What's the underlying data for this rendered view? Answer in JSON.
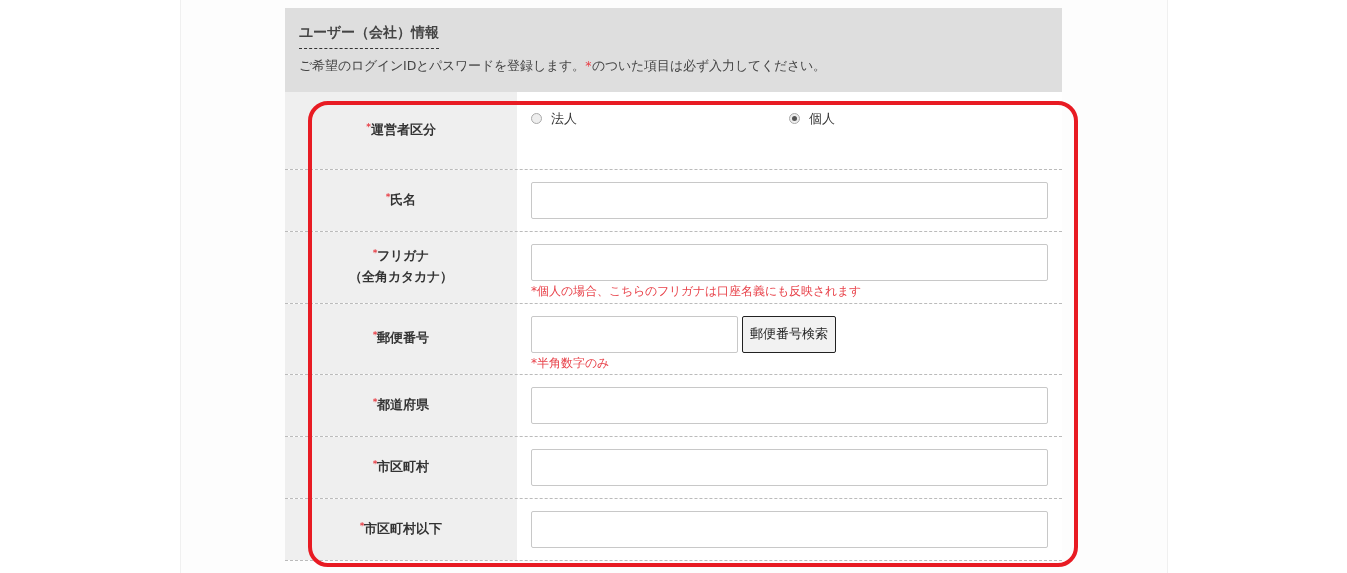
{
  "section": {
    "title": "ユーザー（会社）情報",
    "intro": {
      "before": "ご希望のログインIDとパスワードを登録します。",
      "mark": "*",
      "after": "のついた項目は必ず入力してください。"
    }
  },
  "rows": [
    {
      "kind": "radio",
      "required": true,
      "label": "運営者区分",
      "options": [
        {
          "label": "法人",
          "selected": false
        },
        {
          "label": "個人",
          "selected": true
        }
      ]
    },
    {
      "kind": "text",
      "required": true,
      "label": "氏名"
    },
    {
      "kind": "text",
      "required": true,
      "label": "フリガナ",
      "sublabel": "（全角カタカナ）",
      "note": "*個人の場合、こちらのフリガナは口座名義にも反映されます"
    },
    {
      "kind": "postal",
      "required": true,
      "label": "郵便番号",
      "button": "郵便番号検索",
      "note": "*半角数字のみ"
    },
    {
      "kind": "text",
      "required": true,
      "label": "都道府県"
    },
    {
      "kind": "text",
      "required": true,
      "label": "市区町村"
    },
    {
      "kind": "text",
      "required": true,
      "label": "市区町村以下"
    }
  ]
}
